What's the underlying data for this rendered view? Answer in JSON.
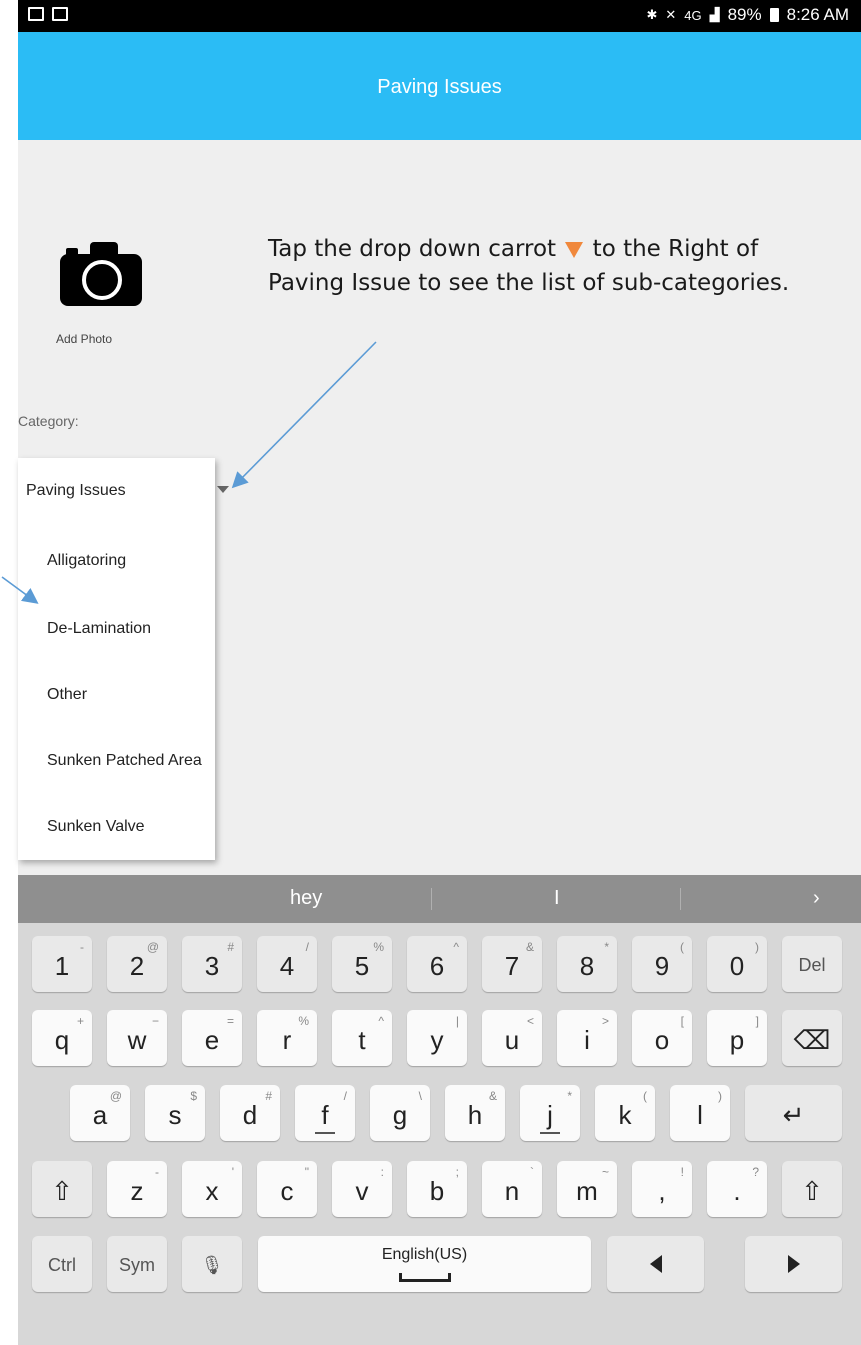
{
  "status_bar": {
    "battery": "89%",
    "time": "8:26 AM",
    "lte": "4G",
    "icons": [
      "gallery-icon",
      "keyboard-icon",
      "bluetooth-icon",
      "mute-icon",
      "lte-icon",
      "signal-icon",
      "battery-icon"
    ]
  },
  "header": {
    "title": "Paving Issues"
  },
  "photo": {
    "label": "Add Photo",
    "icon": "camera-icon"
  },
  "annotation": {
    "text_before": "Tap the drop down carrot",
    "text_after": "to the Right of Paving Issue to see the list of sub-categories.",
    "carrot_color": "#f0883c",
    "arrow_color": "#5b9bd5"
  },
  "category": {
    "label": "Category:",
    "selected": "Paving Issues",
    "options": [
      "Alligatoring",
      "De-Lamination",
      "Other",
      "Sunken Patched Area",
      "Sunken Valve"
    ]
  },
  "keyboard": {
    "suggestions": [
      "hey",
      "I"
    ],
    "more_icon": "chevron-right-icon",
    "row1": [
      {
        "k": "1",
        "s": "-"
      },
      {
        "k": "2",
        "s": "@"
      },
      {
        "k": "3",
        "s": "#"
      },
      {
        "k": "4",
        "s": "/"
      },
      {
        "k": "5",
        "s": "%"
      },
      {
        "k": "6",
        "s": "^"
      },
      {
        "k": "7",
        "s": "&"
      },
      {
        "k": "8",
        "s": "*"
      },
      {
        "k": "9",
        "s": "("
      },
      {
        "k": "0",
        "s": ")"
      }
    ],
    "del": "Del",
    "row2": [
      {
        "k": "q",
        "s": "+"
      },
      {
        "k": "w",
        "s": "−"
      },
      {
        "k": "e",
        "s": "="
      },
      {
        "k": "r",
        "s": "%"
      },
      {
        "k": "t",
        "s": "^"
      },
      {
        "k": "y",
        "s": "|"
      },
      {
        "k": "u",
        "s": "<"
      },
      {
        "k": "i",
        "s": ">"
      },
      {
        "k": "o",
        "s": "["
      },
      {
        "k": "p",
        "s": "]"
      }
    ],
    "row3": [
      {
        "k": "a",
        "s": "@"
      },
      {
        "k": "s",
        "s": "$"
      },
      {
        "k": "d",
        "s": "#"
      },
      {
        "k": "f",
        "s": "/"
      },
      {
        "k": "g",
        "s": "\\"
      },
      {
        "k": "h",
        "s": "&"
      },
      {
        "k": "j",
        "s": "*"
      },
      {
        "k": "k",
        "s": "("
      },
      {
        "k": "l",
        "s": ")"
      }
    ],
    "row4": [
      {
        "k": "z",
        "s": "-"
      },
      {
        "k": "x",
        "s": "'"
      },
      {
        "k": "c",
        "s": "\""
      },
      {
        "k": "v",
        "s": ":"
      },
      {
        "k": "b",
        "s": ";"
      },
      {
        "k": "n",
        "s": "`"
      },
      {
        "k": "m",
        "s": "~"
      },
      {
        "k": ",",
        "s": "!"
      },
      {
        "k": ".",
        "s": "?"
      }
    ],
    "ctrl": "Ctrl",
    "sym": "Sym",
    "language": "English(US)"
  }
}
